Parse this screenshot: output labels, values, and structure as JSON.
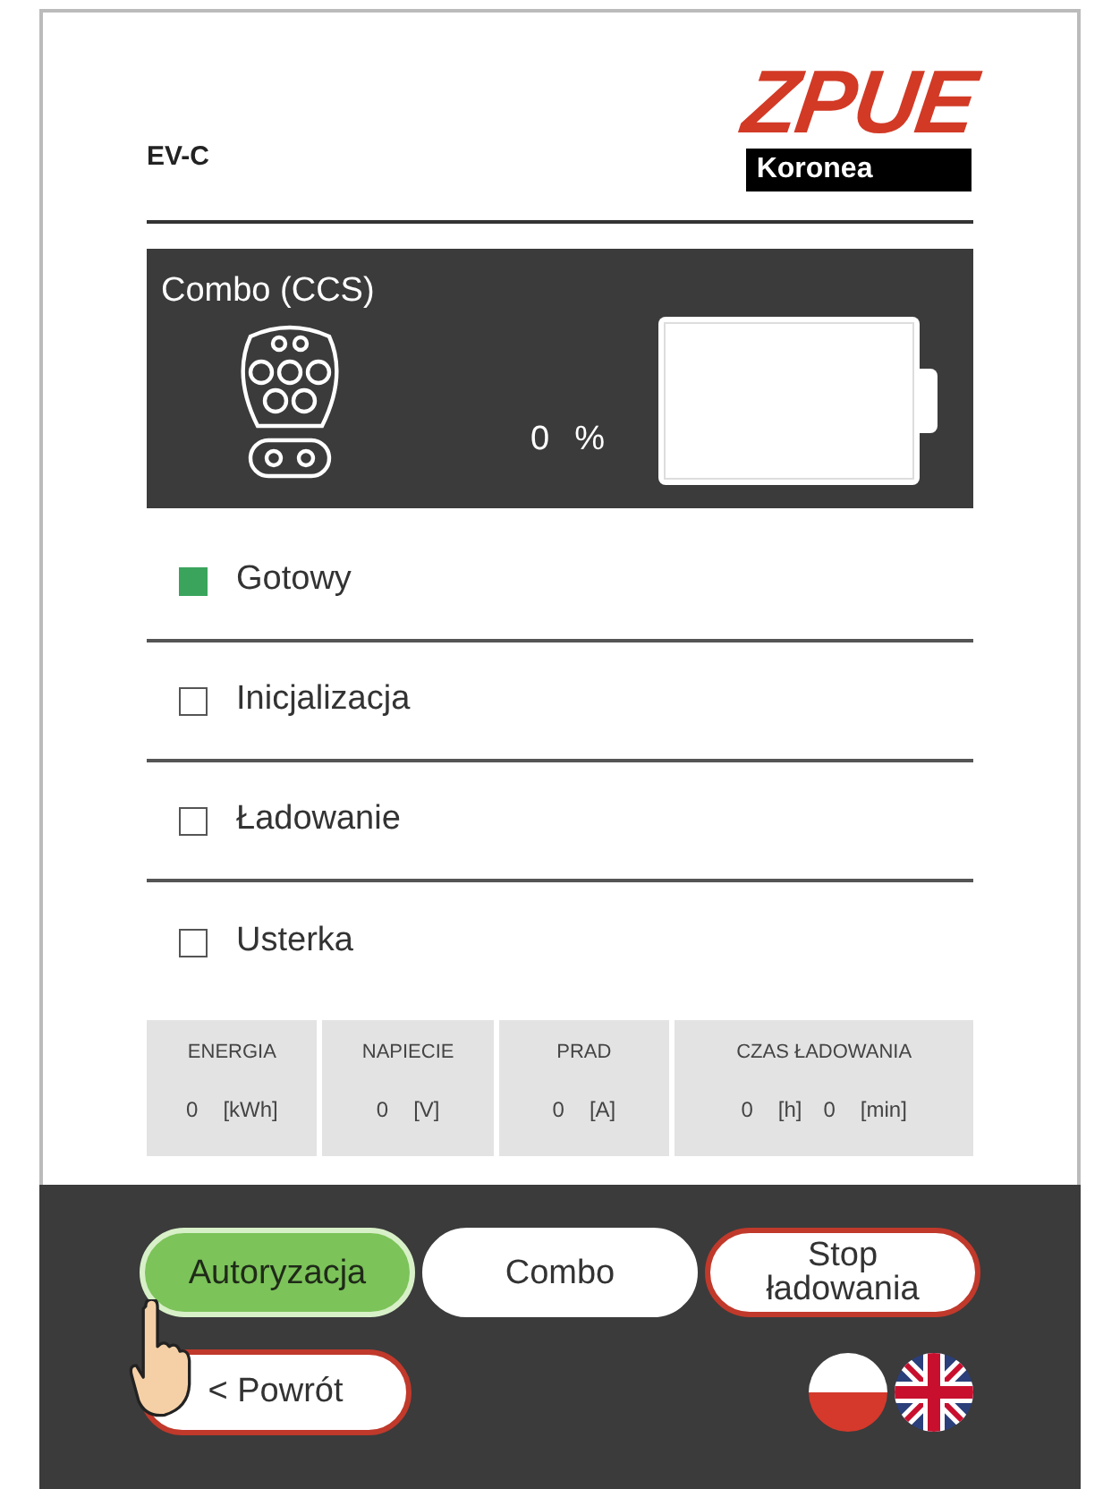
{
  "header": {
    "title": "EV-C",
    "logo_main": "ZPUE",
    "logo_sub": "Koronea"
  },
  "connector": {
    "name": "Combo (CCS)",
    "percent": "0",
    "unit": "%"
  },
  "statuses": [
    {
      "label": "Gotowy",
      "checked": true
    },
    {
      "label": "Inicjalizacja",
      "checked": false
    },
    {
      "label": "Ładowanie",
      "checked": false
    },
    {
      "label": "Usterka",
      "checked": false
    }
  ],
  "metrics": [
    {
      "label": "ENERGIA",
      "values": [
        {
          "value": "0",
          "unit": "[kWh]"
        }
      ]
    },
    {
      "label": "NAPIECIE",
      "values": [
        {
          "value": "0",
          "unit": "[V]"
        }
      ]
    },
    {
      "label": "PRAD",
      "values": [
        {
          "value": "0",
          "unit": "[A]"
        }
      ]
    },
    {
      "label": "CZAS ŁADOWANIA",
      "values": [
        {
          "value": "0",
          "unit": "[h]"
        },
        {
          "value": "0",
          "unit": "[min]"
        }
      ]
    }
  ],
  "buttons": [
    {
      "label": "Autoryzacja",
      "kind": "green"
    },
    {
      "label": "Combo",
      "kind": "white"
    },
    {
      "label": "Stop ładowania",
      "kind": "red"
    }
  ],
  "back_button": {
    "label": "< Powrót"
  },
  "languages": [
    {
      "kind": "pl"
    },
    {
      "kind": "en"
    }
  ],
  "pointer": {
    "kind": "hand"
  }
}
